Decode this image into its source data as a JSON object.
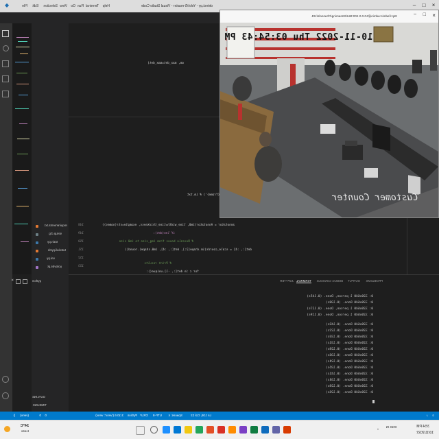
{
  "vscode": {
    "title": "detect.py - YoloV5-master - Visual Studio Code",
    "menu": [
      "File",
      "Edit",
      "Selection",
      "View",
      "Go",
      "Run",
      "Terminal",
      "Help"
    ],
    "code_lines": [
      "om, max_det=max_det)",
      "image' else f'_{frame}') # im.txt",
      "annotator = Annotator(im0, line_width=line_thickness, example=str(names))",
      "if len(det):",
      "# Rescale boxes from img_size to im0 size",
      "det[:, :4] = scale_coords(im.shape[2:], det[:, :4], im0.shape).round()",
      "# Print results",
      "for c in det[:, -1].unique():"
    ],
    "line_numbers": [
      "148",
      "149",
      "150",
      "151",
      "152",
      "153",
      "154",
      "155"
    ],
    "panel_tabs": [
      "PROBLEMS",
      "OUTPUT",
      "DEBUG CONSOLE",
      "TERMINAL",
      "JUPYTER"
    ],
    "active_panel_tab": "TERMINAL",
    "terminal_selector": "python",
    "terminal_lines": [
      "0: 320x640 1 person, Done. (0.145s)",
      "0: 320x640 Done. (0.138s)",
      "0: 320x640 1 person, Done. (0.127s)",
      "0: 320x640 1 person, Done. (0.119s)",
      "0: 320x640 Done. (0.143s)",
      "0: 320x640 Done. (0.122s)",
      "0: 320x640 Done. (0.133s)",
      "0: 320x640 Done. (0.131s)",
      "0: 320x640 Done. (0.128s)",
      "0: 320x640 Done. (0.136s)",
      "0: 320x640 Done. (0.124s)",
      "0: 320x640 Done. (0.135s)",
      "0: 320x640 Done. (0.141s)",
      "0: 320x640 Done. (0.134s)",
      "0: 320x640 Done. (0.128s)",
      "0: 320x640 Done. (0.126s)"
    ],
    "explorer_items": [
      "requirements.txt",
      "setup.cfg",
      "train.py",
      "tutorial.ipynb",
      "val.py",
      "yolov5s.pt"
    ],
    "explorer_colors": [
      "#e37933",
      "#6d8086",
      "#3c78aa",
      "#e37933",
      "#3c78aa",
      "#a074c4"
    ],
    "outline_label": "OUTLINE",
    "timeline_label": "TIMELINE",
    "status": {
      "branch": "(venv)",
      "errors": "0",
      "warnings": "0",
      "position": "Ln 136, Col 22",
      "spaces": "Spaces: 4",
      "encoding": "UTF-8",
      "eol": "CRLF",
      "language": "Python",
      "interpreter": "3.10.6 ('venv': venv)"
    }
  },
  "video_window": {
    "title": "rtsp://admin:admin@10.0.0.100:554/Streaming/Channels/101",
    "timestamp": "10-11-2022 Thu 03:54:43 PM",
    "overlay": "Customer Counter"
  },
  "taskbar": {
    "weather_temp": "24°C",
    "weather_desc": "Haze",
    "language": "ENG IN",
    "time": "3:54 PM",
    "date": "10/11/2022",
    "icon_colors": [
      "#1e90ff",
      "#0078d4",
      "#f2c811",
      "#23a55a",
      "#e34f26",
      "#d93025",
      "#ff8c00",
      "#7b3fc4",
      "#107c41",
      "#0f6cbd",
      "#6264a7",
      "#d83b01"
    ]
  }
}
